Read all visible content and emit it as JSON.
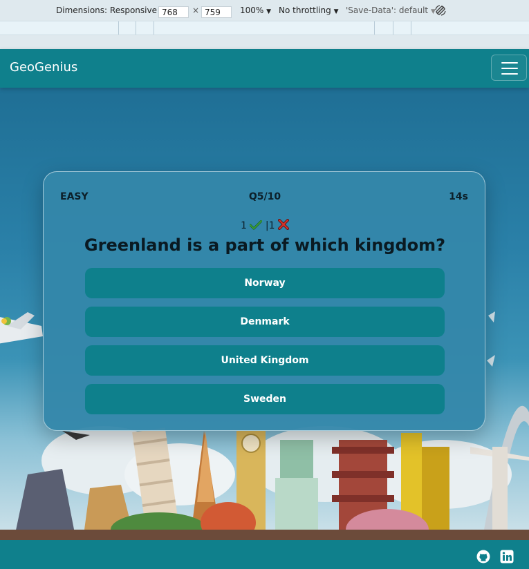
{
  "devtools": {
    "dimensions_label": "Dimensions: Responsive",
    "width_value": "768",
    "times_sign": "×",
    "height_value": "759",
    "zoom": "100%",
    "throttling": "No throttling",
    "save_data": "'Save-Data': default"
  },
  "header": {
    "brand": "GeoGenius",
    "menu_icon": "hamburger-menu-icon"
  },
  "quiz": {
    "difficulty": "EASY",
    "progress": "Q5/10",
    "timer": "14s",
    "correct_count": "1",
    "separator": "|",
    "wrong_count": "1",
    "question": "Greenland is a part of which kingdom?",
    "answers": [
      "Norway",
      "Denmark",
      "United Kingdom",
      "Sweden"
    ]
  },
  "footer": {
    "icons": [
      "github-icon",
      "linkedin-icon"
    ]
  },
  "colors": {
    "primary": "#0f808c",
    "card": "#3487aa",
    "correct": "#3aa238",
    "wrong": "#d6332a"
  }
}
